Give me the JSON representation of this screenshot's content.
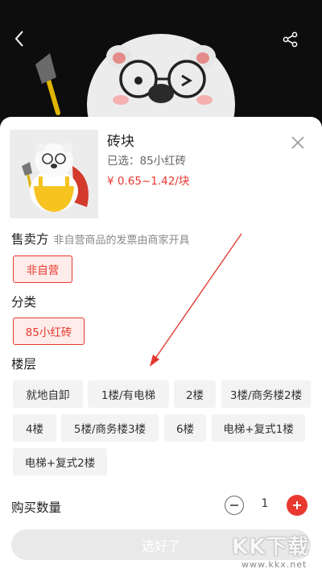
{
  "header": {
    "back_icon": "chevron-left-icon",
    "share_icon": "share-icon"
  },
  "product": {
    "name": "砖块",
    "selected_text": "已选：85小红砖",
    "price": "¥ 0.65~1.42/块",
    "price_color": "#e8382f"
  },
  "seller": {
    "title": "售卖方",
    "note": "非自营商品的发票由商家开具",
    "options": [
      "非自营"
    ],
    "selected": "非自营"
  },
  "category": {
    "title": "分类",
    "options": [
      "85小红砖"
    ],
    "selected": "85小红砖"
  },
  "floor": {
    "title": "楼层",
    "options": [
      "就地自卸",
      "1楼/有电梯",
      "2楼",
      "3楼/商务楼2楼",
      "4楼",
      "5楼/商务楼3楼",
      "6楼",
      "电梯+复式1楼",
      "电梯+复式2楼"
    ]
  },
  "quantity": {
    "label": "购买数量",
    "value": "1"
  },
  "confirm_label": "选好了",
  "watermark": {
    "text": "KK下载",
    "url": "www.kkx.net"
  },
  "colors": {
    "accent": "#e8382f",
    "chip_bg": "#f3f3f3",
    "selected_chip_bg": "#fdecea",
    "button_disabled": "#e9e9e9"
  }
}
